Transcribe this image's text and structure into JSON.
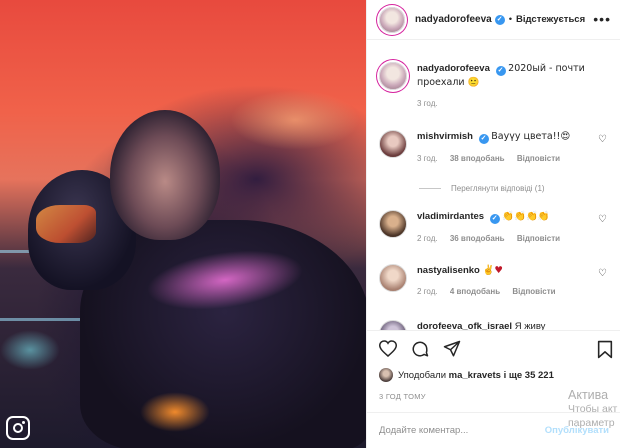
{
  "post": {
    "author": "nadyadorofeeva",
    "follow_status": "Відстежується",
    "caption": "2020ый - почти проехали 🙂",
    "caption_time": "3 год."
  },
  "comments": [
    {
      "user": "mishvirmish",
      "verified": true,
      "text": "Вауүу цвета!!😍",
      "time": "3 год.",
      "likes": "38 вподобань",
      "reply": "Відповісти",
      "view_replies": "Переглянути відповіді (1)"
    },
    {
      "user": "vladimirdantes",
      "verified": true,
      "text": "👏👏👏👏",
      "time": "2 год.",
      "likes": "36 вподобань",
      "reply": "Відповісти"
    },
    {
      "user": "nastyalisenko",
      "verified": false,
      "text": "✌️♥",
      "time": "2 год.",
      "likes": "4 вподобань",
      "reply": "Відповісти"
    },
    {
      "user": "dorofeeva_ofk_israel",
      "verified": false,
      "text": "Я живу"
    }
  ],
  "likes": {
    "prefix": "Уподобали",
    "user": "ma_kravets",
    "suffix": "і ще 35 221"
  },
  "time_ago": "3 ГОД ТОМУ",
  "comment_input": {
    "placeholder": "Додайте коментар...",
    "post_label": "Опублікувати"
  },
  "windows_activation": {
    "line1": "Актива",
    "line2": "Чтобы акт",
    "line3": "параметр"
  },
  "colors": {
    "verified": "#3897f0",
    "link": "#0095f6",
    "post_disabled": "#b2dffc"
  },
  "icons": {
    "like": "heart-icon",
    "comment": "comment-icon",
    "share": "share-icon",
    "save": "bookmark-icon",
    "more": "more-icon"
  }
}
